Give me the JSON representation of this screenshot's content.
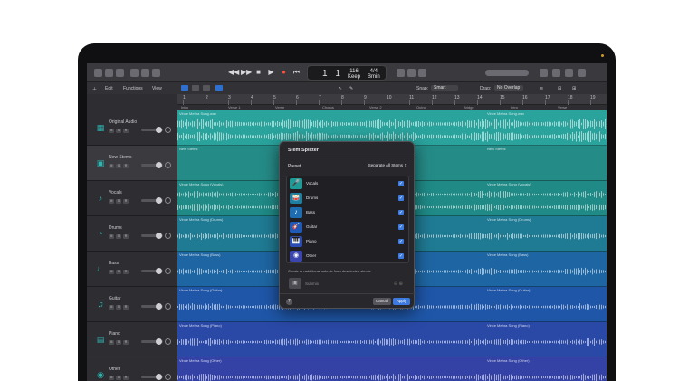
{
  "transport": {
    "play": "▶",
    "stop": "■",
    "record": "●",
    "rewind": "◀◀",
    "forward": "▶▶",
    "start": "⏮"
  },
  "lcd": {
    "position": "1 1",
    "tempo_value": "116",
    "tempo_label": "Keep",
    "sig_value": "4/4",
    "sig_label": "Bmin"
  },
  "toolbar": {
    "edit": "Edit",
    "functions": "Functions",
    "view": "View",
    "snap_label": "Snap:",
    "snap_value": "Smart",
    "drag_label": "Drag:",
    "drag_value": "No Overlap"
  },
  "ruler": [
    "1",
    "2",
    "3",
    "4",
    "5",
    "6",
    "7",
    "8",
    "9",
    "10",
    "11",
    "12",
    "13",
    "14",
    "15",
    "16",
    "17",
    "18",
    "19"
  ],
  "ruler_labels": [
    "Intro",
    "Verse 1",
    "Verse",
    "Chorus",
    "Verse 2",
    "Outro",
    "Bridge",
    "Intro",
    "Verse"
  ],
  "tracks": [
    {
      "name": "Original Audio",
      "color": "#2aa39d",
      "icon": "waveform-icon",
      "label": "Vince Mehra Song.wav",
      "label2": "Vince Mehra Song.wav"
    },
    {
      "name": "New Stems",
      "color": "#258b87",
      "icon": "folder-icon",
      "label": "New Stems",
      "label2": "New Stems"
    },
    {
      "name": "Vocals",
      "color": "#1f8a86",
      "icon": "mic-icon",
      "label": "Vince Mehra Song (Vocals)",
      "label2": "Vince Mehra Song (Vocals)"
    },
    {
      "name": "Drums",
      "color": "#1f7a93",
      "icon": "drum-icon",
      "label": "Vince Mehra Song (Drums)",
      "label2": "Vince Mehra Song (Drums)"
    },
    {
      "name": "Bass",
      "color": "#1e66a3",
      "icon": "bass-icon",
      "label": "Vince Mehra Song (Bass)",
      "label2": "Vince Mehra Song (Bass)"
    },
    {
      "name": "Guitar",
      "color": "#1f56a8",
      "icon": "guitar-icon",
      "label": "Vince Mehra Song (Guitar)",
      "label2": "Vince Mehra Song (Guitar)"
    },
    {
      "name": "Piano",
      "color": "#2a48a6",
      "icon": "piano-icon",
      "label": "Vince Mehra Song (Piano)",
      "label2": "Vince Mehra Song (Piano)"
    },
    {
      "name": "Other",
      "color": "#3442a6",
      "icon": "other-icon",
      "label": "Vince Mehra Song (Other)",
      "label2": "Vince Mehra Song (Other)"
    }
  ],
  "dialog": {
    "title": "Stem Splitter",
    "preset_label": "Preset",
    "preset_value": "Separate All Stems ⇕",
    "stems": [
      {
        "name": "Vocals",
        "icon": "mic-icon",
        "glyph": "🎤",
        "color": "#1f9b97",
        "checked": "✓"
      },
      {
        "name": "Drums",
        "icon": "drum-icon",
        "glyph": "🥁",
        "color": "#1f7fa0",
        "checked": "✓"
      },
      {
        "name": "Bass",
        "icon": "bass-icon",
        "glyph": "♪",
        "color": "#1e6db0",
        "checked": "✓"
      },
      {
        "name": "Guitar",
        "icon": "guitar-icon",
        "glyph": "🎸",
        "color": "#205ab8",
        "checked": "✓"
      },
      {
        "name": "Piano",
        "icon": "piano-icon",
        "glyph": "🎹",
        "color": "#2c4cb4",
        "checked": "✓"
      },
      {
        "name": "Other",
        "icon": "other-icon",
        "glyph": "◉",
        "color": "#3a45b0",
        "checked": "✓"
      }
    ],
    "info": "Create an additional submix from deselected stems.",
    "alt_name": "Submix",
    "alt_glyph": "▣",
    "alt_controls": "⊖ ⊕",
    "help": "?",
    "cancel": "Cancel",
    "apply": "Apply"
  }
}
